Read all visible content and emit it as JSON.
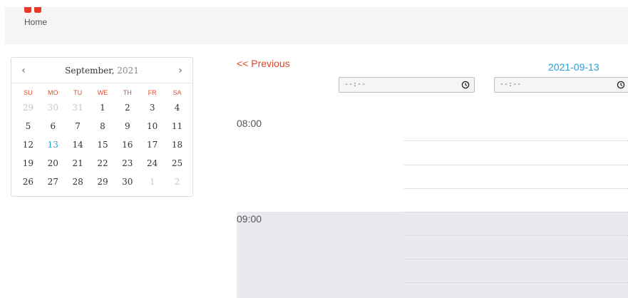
{
  "header": {
    "nav_home_label": "Home"
  },
  "calendar": {
    "month_label": "September,",
    "year_label": "2021",
    "weekday_headers": [
      "SU",
      "MO",
      "TU",
      "WE",
      "TH",
      "FR",
      "SA"
    ],
    "weeks": [
      [
        "29",
        "30",
        "31",
        "1",
        "2",
        "3",
        "4"
      ],
      [
        "5",
        "6",
        "7",
        "8",
        "9",
        "10",
        "11"
      ],
      [
        "12",
        "13",
        "14",
        "15",
        "16",
        "17",
        "18"
      ],
      [
        "19",
        "20",
        "21",
        "22",
        "23",
        "24",
        "25"
      ],
      [
        "26",
        "27",
        "28",
        "29",
        "30",
        "1",
        "2"
      ]
    ],
    "selected_day": "13"
  },
  "schedule": {
    "previous_label": "<< Previous",
    "date": "2021-09-13",
    "start_time_value": "--:--",
    "end_time_value": "--:--",
    "slots": [
      {
        "time": "08:00"
      },
      {
        "time": "09:00"
      }
    ]
  },
  "colors": {
    "accent_red": "#e0452a",
    "accent_blue": "#2a9ed7",
    "busy_block": "#e9eaee"
  },
  "icons": {
    "prev_month": "chevron-left-icon",
    "next_month": "chevron-right-icon",
    "time_picker": "clock-icon"
  }
}
